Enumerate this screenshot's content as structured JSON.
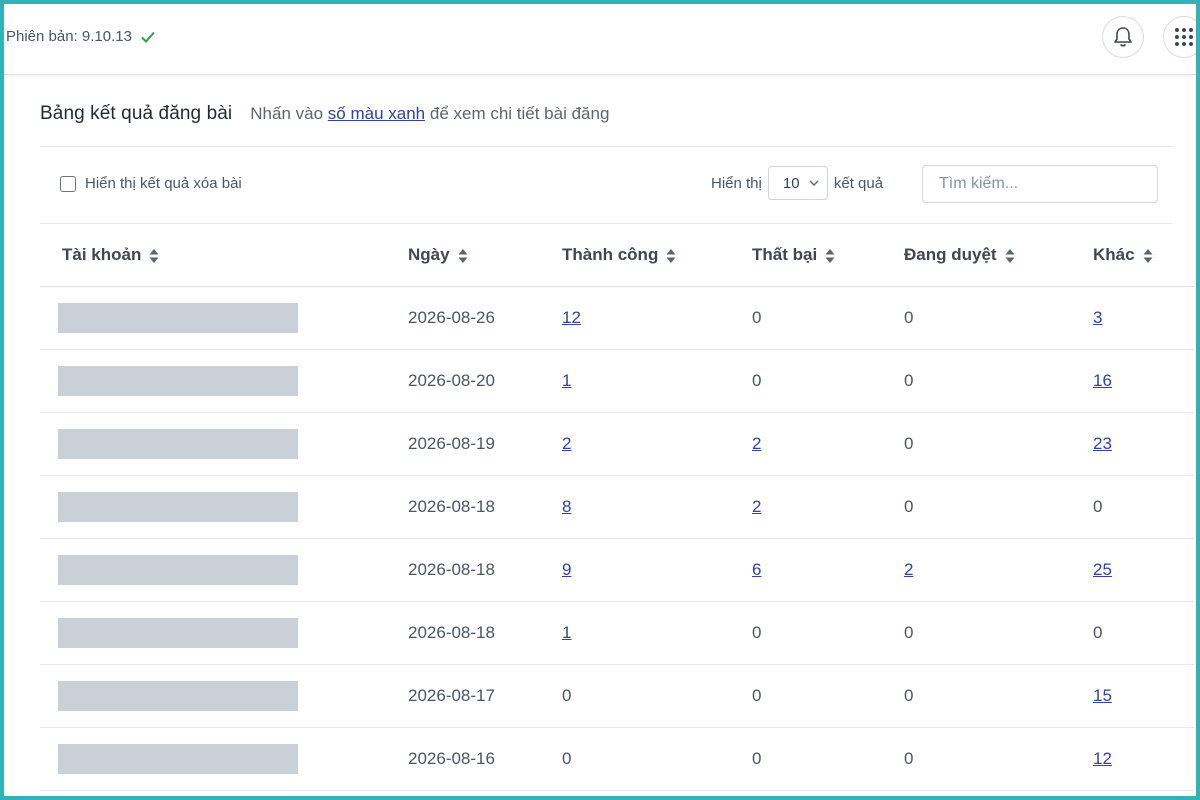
{
  "topbar": {
    "version_label": "Phiên bản: 9.10.13"
  },
  "icons": {
    "status": "check-icon",
    "notifications": "bell-icon",
    "apps": "grid-dots-icon"
  },
  "colors": {
    "frame": "#2fb3b8",
    "link": "#2d43a8",
    "check": "#2e9e3f"
  },
  "card": {
    "title": "Bảng kết quả đăng bài",
    "hint_prefix": "Nhấn vào",
    "hint_link": "số màu xanh",
    "hint_suffix": "để xem chi tiết bài đăng"
  },
  "toolbar": {
    "show_deleted_label": "Hiển thị kết quả xóa bài",
    "show_deleted_checked": false,
    "length_prefix": "Hiển thị",
    "length_value": "10",
    "length_suffix": "kết quả",
    "search_placeholder": "Tìm kiếm..."
  },
  "table": {
    "columns": [
      "Tài khoản",
      "Ngày",
      "Thành công",
      "Thất bại",
      "Đang duyệt",
      "Khác"
    ],
    "rows": [
      {
        "account": "",
        "date": "2026-08-26",
        "success": "12",
        "failed": "0",
        "pending": "0",
        "other": "3"
      },
      {
        "account": "",
        "date": "2026-08-20",
        "success": "1",
        "failed": "0",
        "pending": "0",
        "other": "16"
      },
      {
        "account": "",
        "date": "2026-08-19",
        "success": "2",
        "failed": "2",
        "pending": "0",
        "other": "23"
      },
      {
        "account": "",
        "date": "2026-08-18",
        "success": "8",
        "failed": "2",
        "pending": "0",
        "other": "0"
      },
      {
        "account": "",
        "date": "2026-08-18",
        "success": "9",
        "failed": "6",
        "pending": "2",
        "other": "25"
      },
      {
        "account": "",
        "date": "2026-08-18",
        "success": "1",
        "failed": "0",
        "pending": "0",
        "other": "0"
      },
      {
        "account": "",
        "date": "2026-08-17",
        "success": "0",
        "failed": "0",
        "pending": "0",
        "other": "15"
      },
      {
        "account": "",
        "date": "2026-08-16",
        "success": "0",
        "failed": "0",
        "pending": "0",
        "other": "12"
      }
    ]
  }
}
